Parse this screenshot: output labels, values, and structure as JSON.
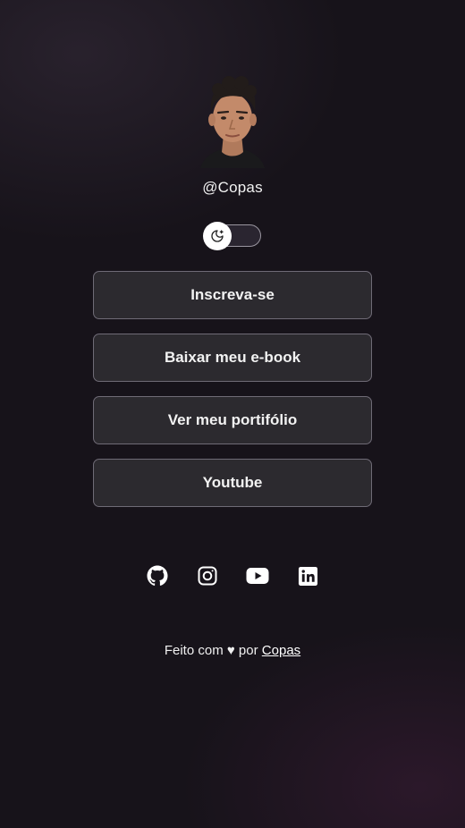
{
  "profile": {
    "handle": "@Copas",
    "avatar_icon": "profile-photo"
  },
  "theme_toggle": {
    "icon": "moon-stars-icon",
    "state": "dark"
  },
  "links": [
    {
      "label": "Inscreva-se"
    },
    {
      "label": "Baixar meu e-book"
    },
    {
      "label": "Ver meu portifólio"
    },
    {
      "label": "Youtube"
    }
  ],
  "social": [
    {
      "name": "github",
      "icon": "github-icon"
    },
    {
      "name": "instagram",
      "icon": "instagram-icon"
    },
    {
      "name": "youtube",
      "icon": "youtube-icon"
    },
    {
      "name": "linkedin",
      "icon": "linkedin-icon"
    }
  ],
  "footer": {
    "text": "Feito com ♥ por",
    "link_text": "Copas"
  },
  "colors": {
    "background": "#17131a",
    "button_bg": "#2c2a2f",
    "button_border": "#6f6b76",
    "text": "#ffffff"
  }
}
